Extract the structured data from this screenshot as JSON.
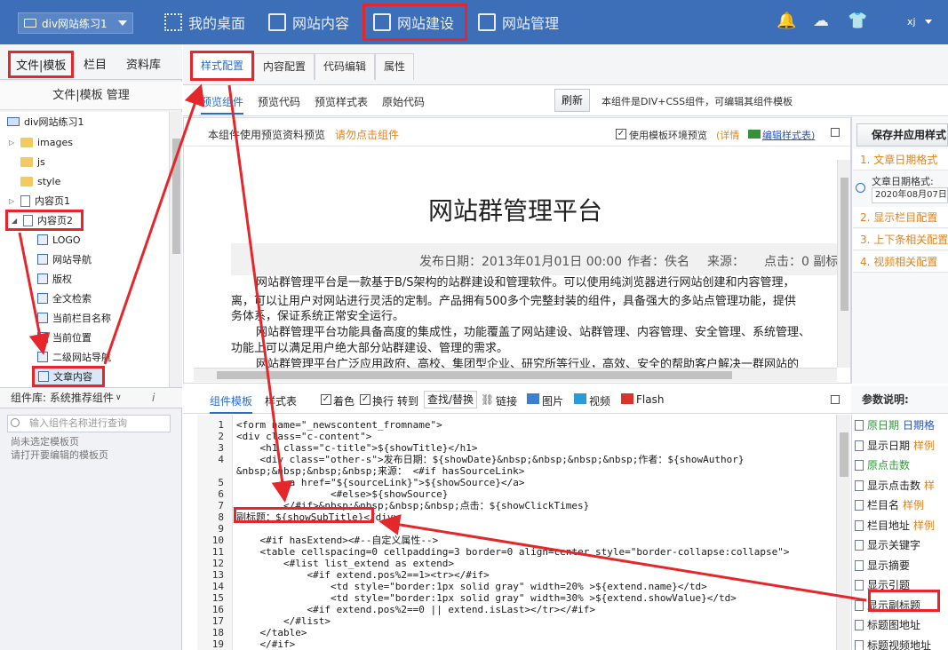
{
  "topbar": {
    "site_selector": "div网站练习1",
    "nav": [
      "我的桌面",
      "网站内容",
      "网站建设",
      "网站管理"
    ],
    "user": "xj"
  },
  "left": {
    "tabs": [
      "文件|模板",
      "栏目",
      "资料库"
    ],
    "header": "文件|模板 管理",
    "tree": [
      {
        "label": "div网站练习1",
        "kind": "site"
      },
      {
        "label": "images",
        "kind": "folder"
      },
      {
        "label": "js",
        "kind": "folder"
      },
      {
        "label": "style",
        "kind": "folder"
      },
      {
        "label": "内容页1",
        "kind": "page"
      },
      {
        "label": "内容页2",
        "kind": "page"
      },
      {
        "label": "LOGO",
        "kind": "comp"
      },
      {
        "label": "网站导航",
        "kind": "comp"
      },
      {
        "label": "版权",
        "kind": "comp"
      },
      {
        "label": "全文检索",
        "kind": "comp"
      },
      {
        "label": "当前栏目名称",
        "kind": "comp"
      },
      {
        "label": "当前位置",
        "kind": "comp"
      },
      {
        "label": "二级网站导航",
        "kind": "comp"
      },
      {
        "label": "文章内容",
        "kind": "comp"
      }
    ],
    "library": "组件库: 系统推荐组件",
    "library_icon": "i",
    "search_placeholder": "输入组件名称进行查询",
    "empty_notes": [
      "尚未选定模板页",
      "请打开要编辑的模板页"
    ]
  },
  "main": {
    "tabs": [
      "样式配置",
      "内容配置",
      "代码编辑",
      "属性"
    ],
    "subtabs": [
      "预览组件",
      "预览代码",
      "预览样式表",
      "原始代码"
    ],
    "refresh": "刷新",
    "component_note": "本组件是DIV+CSS组件，可编辑其组件模板",
    "preview_note": "本组件使用预览资料预览",
    "preview_warn": "请勿点击组件",
    "use_env": "使用模板环境预览",
    "detail": "(详情",
    "edit_css": "编辑样式表)",
    "save_btn": "保存并应用样式",
    "preview": {
      "title": "网站群管理平台",
      "publish_date": "发布日期：2013年01月01日 00:00",
      "author": "作者：佚名",
      "source": "来源：",
      "clicks": "点击：0 副标",
      "paragraphs": [
        "网站群管理平台是一款基于B/S架构的站群建设和管理软件。可以使用纯浏览器进行网站创建和内容管理，",
        "离，可以让用户对网站进行灵活的定制。产品拥有500多个完整封装的组件，具备强大的多站点管理功能，提供",
        "务体系，保证系统正常安全运行。",
        "网站群管理平台功能具备高度的集成性，功能覆盖了网站建设、站群管理、内容管理、安全管理、系统管理、",
        "功能上可以满足用户绝大部分站群建设、管理的需求。",
        "网站群管理平台广泛应用政府、高校、集团型企业、研究所等行业，高效、安全的帮助客户解决一群网站的"
      ]
    },
    "config_items": [
      "1. 文章日期格式",
      "2. 显示栏目配置",
      "3. 上下条相关配置",
      "4. 视频相关配置"
    ],
    "date_label": "文章日期格式:",
    "date_value": "2020年08月07日"
  },
  "editor": {
    "tabs": [
      "组件模板",
      "样式表"
    ],
    "tools": [
      "着色",
      "换行",
      "转到",
      "查找/替换",
      "链接",
      "图片",
      "视频",
      "Flash"
    ],
    "line_numbers": [
      "1",
      "2",
      "3",
      "4",
      "",
      "5",
      "6",
      "7",
      "8",
      "9",
      "10",
      "11",
      "12",
      "13",
      "14",
      "15",
      "16",
      "17",
      "18",
      "19"
    ],
    "lines": [
      "<form name=\"_newscontent_fromname\">",
      "<div class=\"c-content\">",
      "    <h1 class=\"c-title\">${showTitle}</h1>",
      "    <div class=\"other-s\">发布日期：${showDate}&nbsp;&nbsp;&nbsp;&nbsp;作者：${showAuthor}",
      "&nbsp;&nbsp;&nbsp;&nbsp;来源： <#if hasSourceLink>",
      "        <a href=\"${sourceLink}\">${showSource}</a>",
      "                <#else>${showSource}",
      "        </#if>&nbsp;&nbsp;&nbsp;&nbsp;点击：${showClickTimes}",
      "副标题：${showSubTitle}</div>",
      "",
      "    <#if hasExtend><#--自定义属性-->",
      "    <table cellspacing=0 cellpadding=3 border=0 align=center style=\"border-collapse:collapse\">",
      "        <#list list_extend as extend>",
      "            <#if extend.pos%2==1><tr></#if>",
      "                <td style=\"border:1px solid gray\" width=20% >${extend.name}</td>",
      "                <td style=\"border:1px solid gray\" width=30% >${extend.showValue}</td>",
      "            <#if extend.pos%2==0 || extend.isLast></tr></#if>",
      "        </#list>",
      "    </table>",
      "    </#if>"
    ]
  },
  "params": {
    "header": "参数说明:",
    "items": [
      {
        "label": "原日期",
        "extra": "日期格"
      },
      {
        "label": "显示日期",
        "extra": "样例"
      },
      {
        "label": "原点击数",
        "extra": ""
      },
      {
        "label": "显示点击数",
        "extra": "样"
      },
      {
        "label": "栏目名",
        "extra": "样例"
      },
      {
        "label": "栏目地址",
        "extra": "样例"
      },
      {
        "label": "显示关键字",
        "extra": ""
      },
      {
        "label": "显示摘要",
        "extra": ""
      },
      {
        "label": "显示引题",
        "extra": ""
      },
      {
        "label": "显示副标题",
        "extra": ""
      },
      {
        "label": "标题图地址",
        "extra": ""
      },
      {
        "label": "标题视频地址",
        "extra": ""
      }
    ]
  },
  "colors": {
    "topbar": "#3d6fb8",
    "highlight": "#e5262b",
    "accent": "#2a6dc8",
    "orange": "#e0821c"
  }
}
